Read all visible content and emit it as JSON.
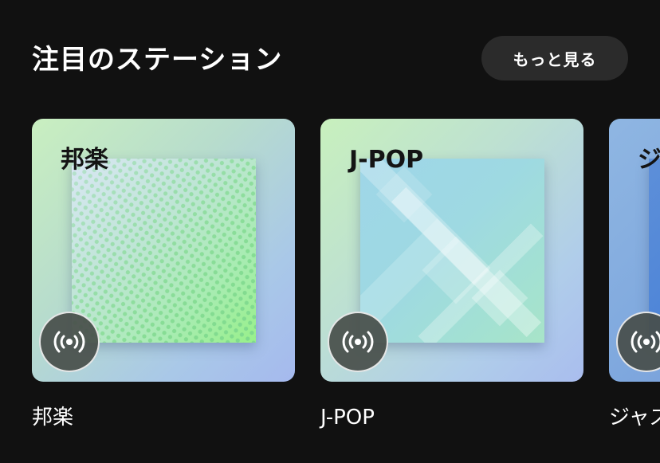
{
  "section": {
    "title": "注目のステーション",
    "more_label": "もっと見る"
  },
  "stations": [
    {
      "art_caption": "邦楽",
      "title": "邦楽"
    },
    {
      "art_caption": "J-POP",
      "title": "J-POP"
    },
    {
      "art_caption": "ジ",
      "title": "ジャズ"
    }
  ],
  "icons": {
    "live_badge": "radio-broadcast-icon"
  },
  "colors": {
    "background": "#111111",
    "button_bg": "#2b2b2b",
    "text": "#ffffff"
  }
}
